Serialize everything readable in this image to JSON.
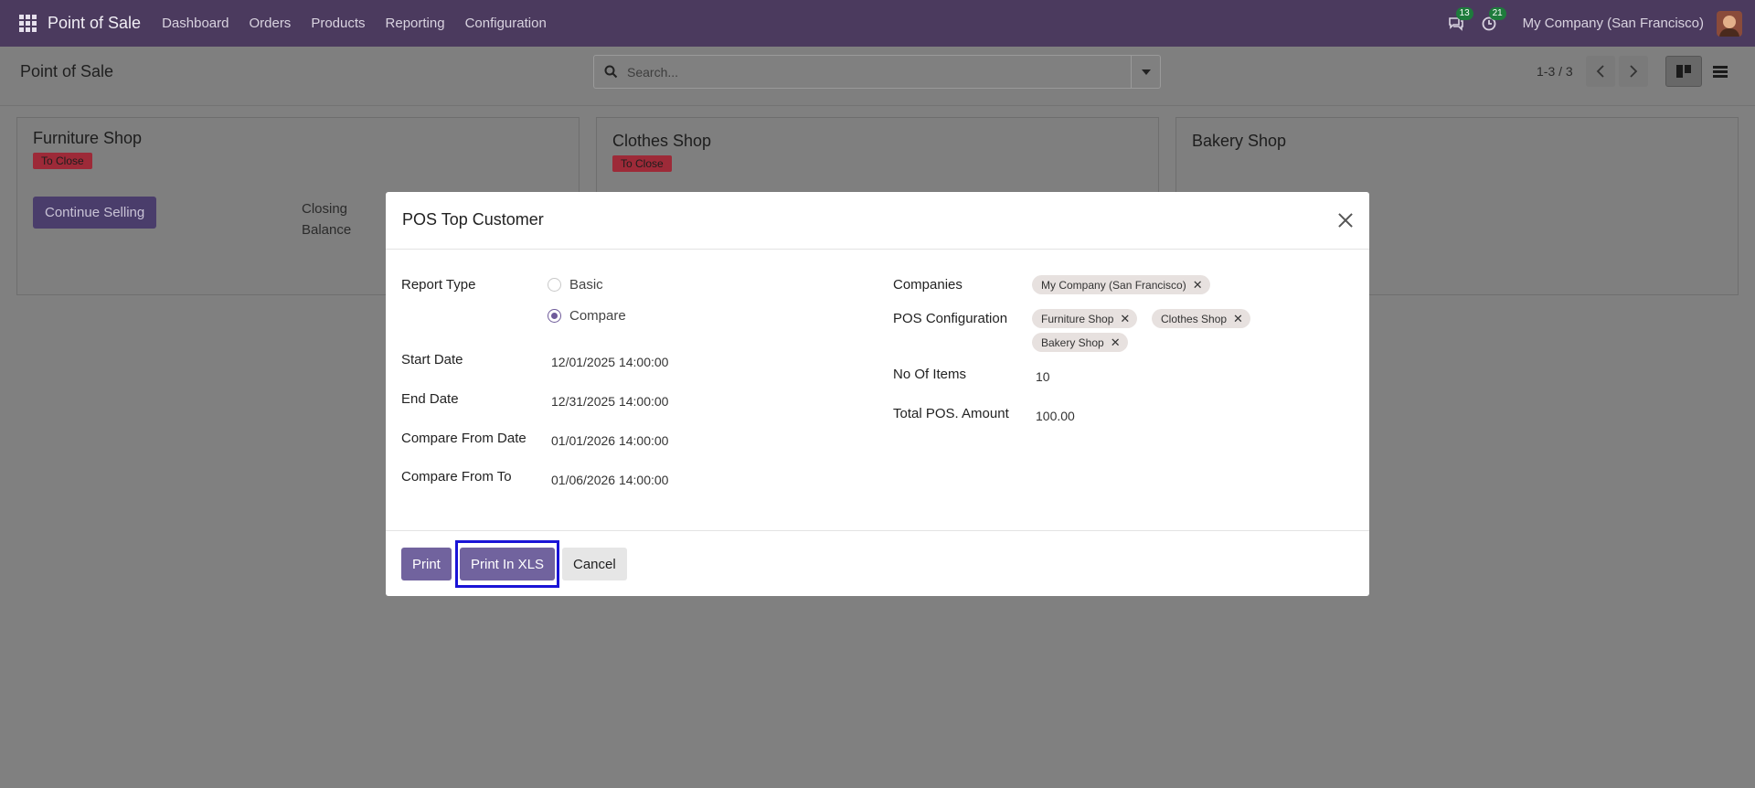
{
  "navbar": {
    "app_name": "Point of Sale",
    "menu": [
      "Dashboard",
      "Orders",
      "Products",
      "Reporting",
      "Configuration"
    ],
    "messages_count": "13",
    "activities_count": "21",
    "company": "My Company (San Francisco)"
  },
  "control": {
    "title": "Point of Sale",
    "search_placeholder": "Search...",
    "pager": "1-3 / 3"
  },
  "cards": [
    {
      "name": "Furniture Shop",
      "badge": "To Close",
      "button": "Continue Selling",
      "closing_label": "Closing",
      "closing_label2": "Balance"
    },
    {
      "name": "Clothes Shop",
      "badge": "To Close"
    },
    {
      "name": "Bakery Shop"
    }
  ],
  "dialog": {
    "title": "POS Top Customer",
    "report_type_label": "Report Type",
    "report_type_options": [
      "Basic",
      "Compare"
    ],
    "report_type_selected": "Compare",
    "start_date_label": "Start Date",
    "start_date": "12/01/2025 14:00:00",
    "end_date_label": "End Date",
    "end_date": "12/31/2025 14:00:00",
    "compare_from_label": "Compare From Date",
    "compare_from": "01/01/2026 14:00:00",
    "compare_to_label": "Compare From To",
    "compare_to": "01/06/2026 14:00:00",
    "companies_label": "Companies",
    "companies": [
      "My Company (San Francisco)"
    ],
    "pos_config_label": "POS Configuration",
    "pos_configs": [
      "Furniture Shop",
      "Clothes Shop",
      "Bakery Shop"
    ],
    "no_items_label": "No Of Items",
    "no_items": "10",
    "total_label": "Total POS. Amount",
    "total": "100.00",
    "buttons": {
      "print": "Print",
      "print_xls": "Print In XLS",
      "cancel": "Cancel"
    }
  },
  "colors": {
    "navbar": "#4b3a5e",
    "primary": "#71639e",
    "badge": "#9d2a38",
    "highlight": "#1a14d6"
  }
}
